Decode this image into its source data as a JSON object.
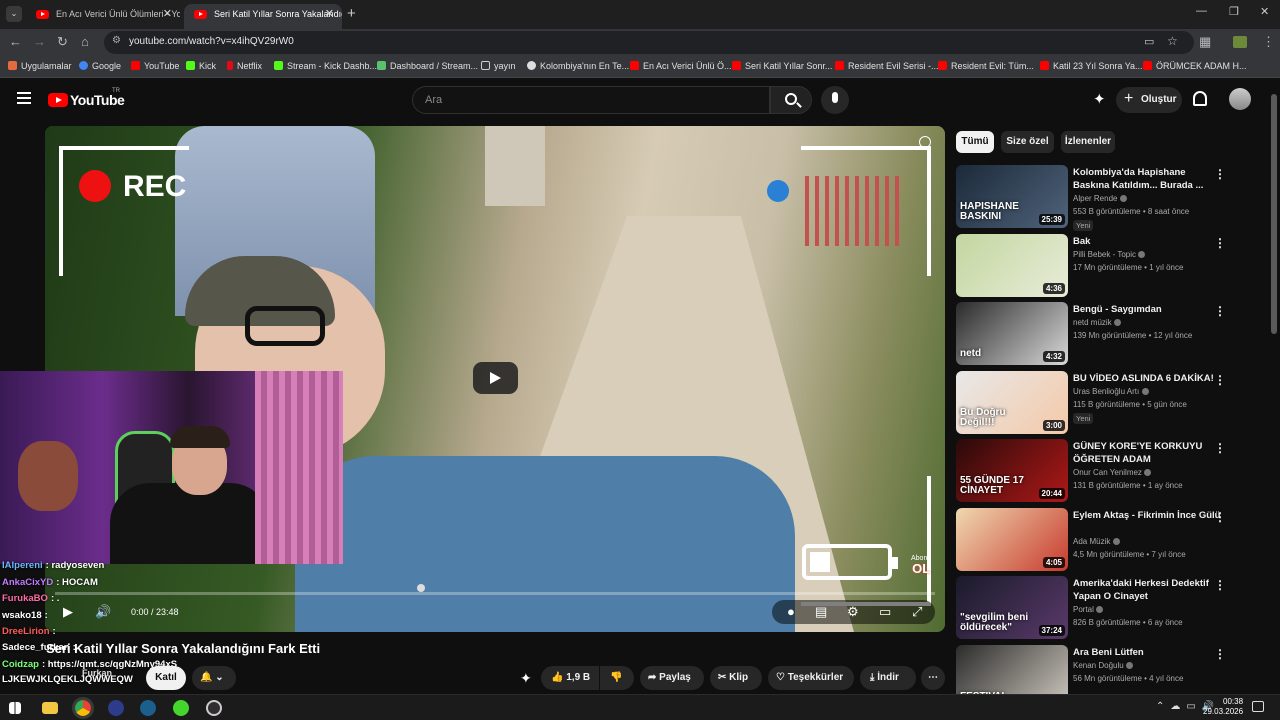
{
  "browser": {
    "tabs": [
      {
        "label": "En Acı Verici Ünlü Ölümleri - Yo",
        "active": false
      },
      {
        "label": "Seri Katil Yıllar Sonra Yakalandığ",
        "active": true
      }
    ],
    "new_tab": "+",
    "url": "youtube.com/watch?v=x4ihQV29rW0",
    "bookmarks": [
      "Uygulamalar",
      "Google",
      "YouTube",
      "Kick",
      "Netflix",
      "Stream - Kick Dashb...",
      "Dashboard / Stream...",
      "yayın",
      "Kolombiya'nın En Te...",
      "En Acı Verici Ünlü Ö...",
      "Seri Katil Yıllar Sonr...",
      "Resident Evil Serisi -...",
      "Resident Evil: Tüm...",
      "Katil 23 Yıl Sonra Ya...",
      "ÖRÜMCEK ADAM H..."
    ]
  },
  "youtube": {
    "logo": "YouTube",
    "logo_suffix": "TR",
    "search_placeholder": "Ara",
    "create_label": "Oluştur"
  },
  "player": {
    "rec_label": "REC",
    "time": "0:00 / 23:48",
    "progress": 0.0,
    "abone": "Abone",
    "ol": "OL"
  },
  "video": {
    "title": "Seri Katil Yıllar Sonra Yakalandığını Fark Etti",
    "channel": "Furkan",
    "join_label": "Katıl",
    "likes": "1,9 B",
    "share": "Paylaş",
    "clip": "Klip",
    "thanks": "Teşekkürler",
    "download": "İndir"
  },
  "chat": [
    {
      "user": "IAlpereni",
      "msg": ": radyoseven",
      "color": "#6fb7ff"
    },
    {
      "user": "AnkaCixYD",
      "msg": ": HOCAM",
      "color": "#c27bff"
    },
    {
      "user": "FurukaBO",
      "msg": ": .",
      "color": "#ff6aa6"
    },
    {
      "user": "wsako18",
      "msg": ":",
      "color": "#ffffff"
    },
    {
      "user": "DreeLirion",
      "msg": ":",
      "color": "#ff5a5a"
    },
    {
      "user": "Sadece_furkan",
      "msg": ":",
      "color": "#ffffff"
    },
    {
      "user": "Coidzap",
      "msg": ": https://qmt.sc/qgNzMny94xS",
      "color": "#7bff7b"
    },
    {
      "user": "LJKEWJKLQEKLJQWWEQW",
      "msg": "",
      "color": "#ffffff"
    }
  ],
  "rail": {
    "chips": [
      "Tümü",
      "Size özel",
      "İzlenenler"
    ],
    "items": [
      {
        "title": "Kolombiya'da Hapishane Baskına Katıldım... Burada ...",
        "channel": "Alper Rende",
        "meta": "553 B görüntüleme • 8 saat önce",
        "badge": "Yeni",
        "duration": "25:39",
        "thumb_text": "HAPISHANE BASKINI",
        "colors": [
          "#1b2a3a",
          "#50637a"
        ]
      },
      {
        "title": "Bak",
        "channel": "Pilli Bebek - Topic",
        "meta": "17 Mn görüntüleme • 1 yıl önce",
        "badge": "",
        "duration": "4:36",
        "thumb_text": "",
        "colors": [
          "#c3d6a0",
          "#e8ecd8"
        ]
      },
      {
        "title": "Bengü - Saygımdan",
        "channel": "netd müzik",
        "meta": "139 Mn görüntüleme • 12 yıl önce",
        "badge": "",
        "duration": "4:32",
        "thumb_text": "netd",
        "colors": [
          "#2a2a2a",
          "#d9d9d9"
        ]
      },
      {
        "title": "BU VİDEO ASLINDA 6 DAKİKA!",
        "channel": "Uras Benlioğlu Artı",
        "meta": "115 B görüntüleme • 5 gün önce",
        "badge": "Yeni",
        "duration": "3:00",
        "thumb_text": "Bu Doğru Değil!!!",
        "colors": [
          "#e8e8e8",
          "#f4c9a8"
        ]
      },
      {
        "title": "GÜNEY KORE'YE KORKUYU ÖĞRETEN ADAM",
        "channel": "Onur Can Yenilmez",
        "meta": "131 B görüntüleme • 1 ay önce",
        "badge": "",
        "duration": "20:44",
        "thumb_text": "55 GÜNDE 17 CİNAYET",
        "colors": [
          "#2a0a0a",
          "#b01818"
        ]
      },
      {
        "title": "Eylem Aktaş - Fikrimin İnce Gülü",
        "channel": "Ada Müzik",
        "meta": "4,5 Mn görüntüleme • 7 yıl önce",
        "badge": "",
        "duration": "4:05",
        "thumb_text": "",
        "colors": [
          "#f0d9b0",
          "#c73a2e"
        ]
      },
      {
        "title": "Amerika'daki Herkesi Dedektif Yapan O Cinayet",
        "channel": "Portal",
        "meta": "826 B görüntüleme • 6 ay önce",
        "badge": "",
        "duration": "37:24",
        "thumb_text": "\"sevgilim beni öldürecek\"",
        "colors": [
          "#1a1a2a",
          "#5a3a6a"
        ]
      },
      {
        "title": "Ara Beni Lütfen",
        "channel": "Kenan Doğulu",
        "meta": "56 Mn görüntüleme • 4 yıl önce",
        "badge": "",
        "duration": "",
        "thumb_text": "FESTIVAL",
        "colors": [
          "#2b2b2b",
          "#cfc9bf"
        ]
      }
    ]
  },
  "taskbar": {
    "time": "00:38",
    "date": "29.03.2026"
  }
}
